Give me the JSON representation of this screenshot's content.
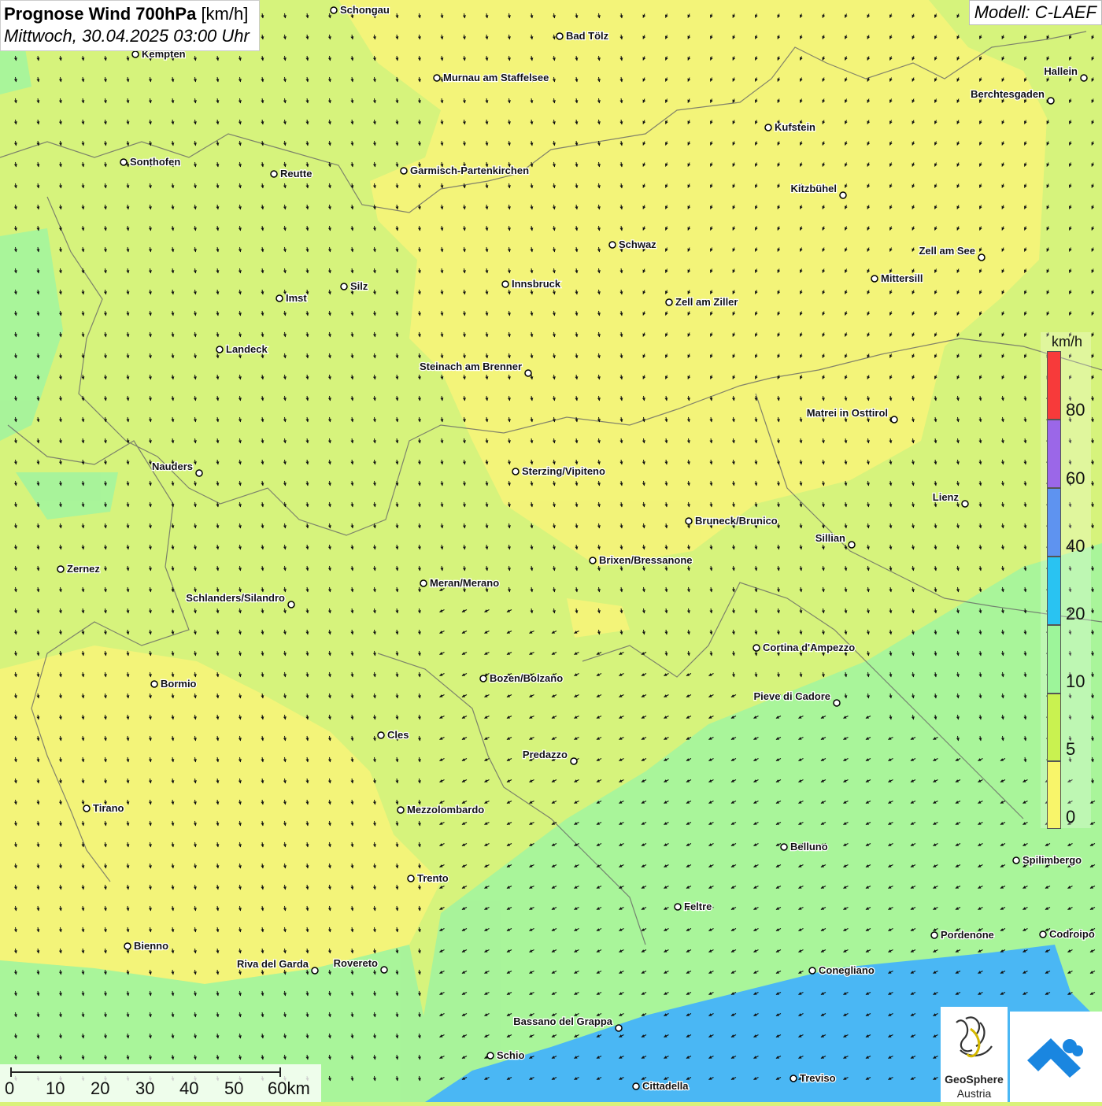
{
  "title": {
    "bold": "Prognose Wind 700hPa",
    "unit": "[km/h]",
    "subtitle": "Mittwoch, 30.04.2025 03:00 Uhr"
  },
  "model_label": "Modell: C-LAEF",
  "legend": {
    "unit": "km/h",
    "ticks": [
      "80",
      "60",
      "40",
      "20",
      "10",
      "5",
      "0"
    ],
    "colors": [
      "#f73a3a",
      "#9b67e8",
      "#5e93f0",
      "#29c3f2",
      "#9df59a",
      "#c9f250",
      "#f8f56a"
    ]
  },
  "scale_bar": {
    "labels": [
      "0",
      "10",
      "20",
      "30",
      "40",
      "50",
      "60km"
    ]
  },
  "logos": {
    "geosphere_line1": "GeoSphere",
    "geosphere_line2": "Austria"
  },
  "cities": [
    {
      "name": "Schongau"
    },
    {
      "name": "Bad Tölz"
    },
    {
      "name": "Kempten"
    },
    {
      "name": "Murnau am Staffelsee"
    },
    {
      "name": "Hallein"
    },
    {
      "name": "Berchtesgaden"
    },
    {
      "name": "Kufstein"
    },
    {
      "name": "Sonthofen"
    },
    {
      "name": "Reutte"
    },
    {
      "name": "Garmisch-Partenkirchen"
    },
    {
      "name": "Kitzbühel"
    },
    {
      "name": "Schwaz"
    },
    {
      "name": "Zell am See"
    },
    {
      "name": "Innsbruck"
    },
    {
      "name": "Mittersill"
    },
    {
      "name": "Silz"
    },
    {
      "name": "Imst"
    },
    {
      "name": "Zell am Ziller"
    },
    {
      "name": "Landeck"
    },
    {
      "name": "Steinach am Brenner"
    },
    {
      "name": "Matrei in Osttirol"
    },
    {
      "name": "Nauders"
    },
    {
      "name": "Sterzing/Vipiteno"
    },
    {
      "name": "Lienz"
    },
    {
      "name": "Bruneck/Brunico"
    },
    {
      "name": "Sillian"
    },
    {
      "name": "Zernez"
    },
    {
      "name": "Brixen/Bressanone"
    },
    {
      "name": "Meran/Merano"
    },
    {
      "name": "Schlanders/Silandro"
    },
    {
      "name": "Cortina d'Ampezzo"
    },
    {
      "name": "Bozen/Bolzano"
    },
    {
      "name": "Bormio"
    },
    {
      "name": "Pieve di Cadore"
    },
    {
      "name": "Cles"
    },
    {
      "name": "Predazzo"
    },
    {
      "name": "Tirano"
    },
    {
      "name": "Mezzolombardo"
    },
    {
      "name": "Belluno"
    },
    {
      "name": "Spilimbergo"
    },
    {
      "name": "Trento"
    },
    {
      "name": "Feltre"
    },
    {
      "name": "Pordenone"
    },
    {
      "name": "Codroipo"
    },
    {
      "name": "Bienno"
    },
    {
      "name": "Riva del Garda"
    },
    {
      "name": "Rovereto"
    },
    {
      "name": "Conegliano"
    },
    {
      "name": "Bassano del Grappa"
    },
    {
      "name": "Schio"
    },
    {
      "name": "Treviso"
    },
    {
      "name": "Cittadella"
    }
  ]
}
